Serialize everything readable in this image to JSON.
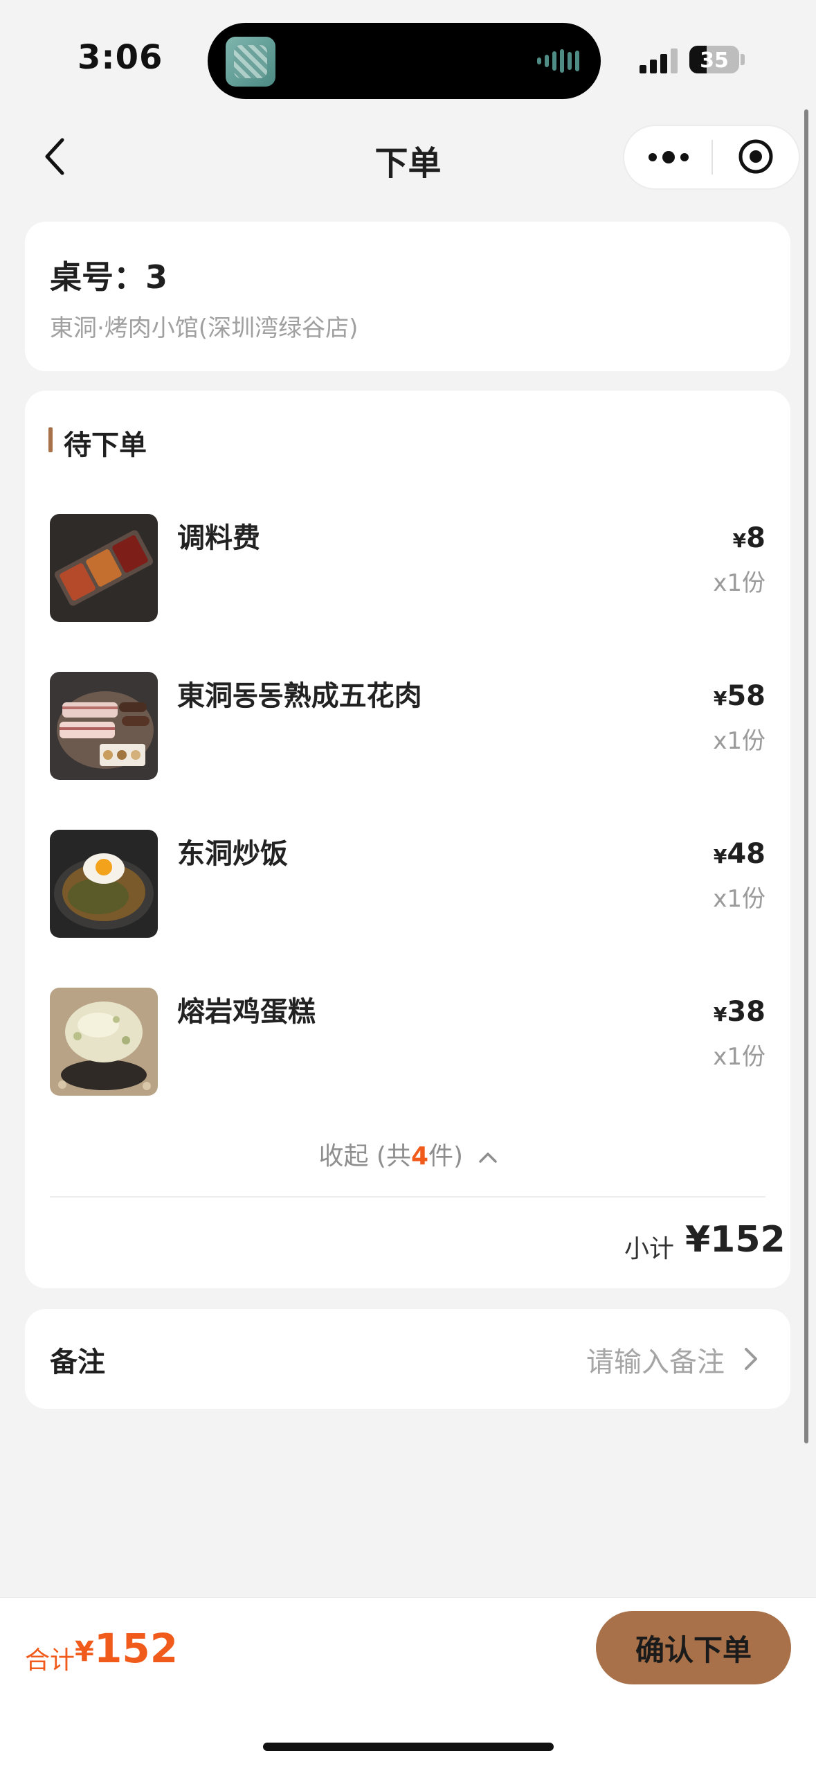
{
  "status_bar": {
    "time": "3:06",
    "battery": "35"
  },
  "nav": {
    "title": "下单"
  },
  "table": {
    "label": "桌号：3",
    "shop": "東洞·烤肉小馆(深圳湾绿谷店)"
  },
  "pending": {
    "title": "待下单",
    "items": [
      {
        "name": "调料费",
        "currency": "¥",
        "price": "8",
        "qty": "x1份",
        "image": "seasoning-tray-image"
      },
      {
        "name": "東洞동동熟成五花肉",
        "currency": "¥",
        "price": "58",
        "qty": "x1份",
        "image": "pork-belly-image"
      },
      {
        "name": "东洞炒饭",
        "currency": "¥",
        "price": "48",
        "qty": "x1份",
        "image": "fried-rice-image"
      },
      {
        "name": "熔岩鸡蛋糕",
        "currency": "¥",
        "price": "38",
        "qty": "x1份",
        "image": "egg-cake-image"
      }
    ],
    "collapse": {
      "prefix": "收起 (共",
      "count": "4",
      "suffix": "件)"
    },
    "subtotal_label": "小计",
    "subtotal_value": "¥152"
  },
  "note": {
    "label": "备注",
    "placeholder": "请输入备注"
  },
  "footer": {
    "total_label": "合计",
    "total_currency": "¥",
    "total_value": "152",
    "confirm_label": "确认下单"
  },
  "colors": {
    "accent_brown": "#a8714a",
    "price_orange": "#f05a1a",
    "background": "#f3f3f3"
  }
}
